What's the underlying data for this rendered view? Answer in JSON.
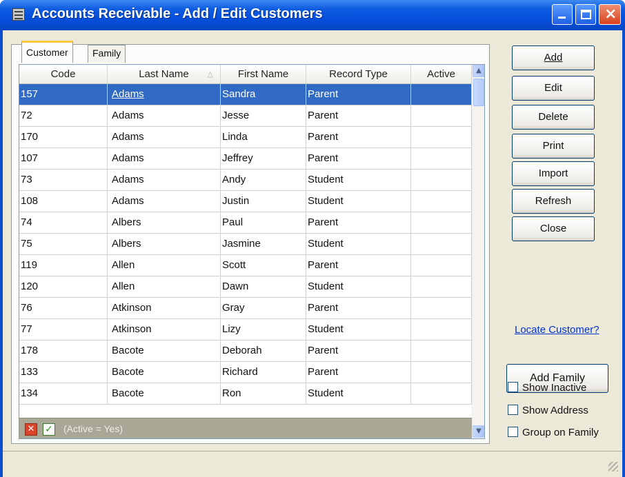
{
  "window": {
    "title": "Accounts Receivable - Add / Edit Customers",
    "close_glyph": "×"
  },
  "tabs": [
    {
      "label": "Customer",
      "active": true
    },
    {
      "label": "Family",
      "active": false
    }
  ],
  "grid": {
    "columns": [
      "Code",
      "Last Name",
      "First Name",
      "Record Type",
      "Active"
    ],
    "sort_column": "Last Name",
    "sort_icon": "sort-ascending-icon",
    "rows": [
      {
        "code": "157",
        "last": "Adams",
        "first": "Sandra",
        "type": "Parent",
        "active": "",
        "selected": true
      },
      {
        "code": "72",
        "last": "Adams",
        "first": "Jesse",
        "type": "Parent",
        "active": ""
      },
      {
        "code": "170",
        "last": "Adams",
        "first": "Linda",
        "type": "Parent",
        "active": ""
      },
      {
        "code": "107",
        "last": "Adams",
        "first": "Jeffrey",
        "type": "Parent",
        "active": ""
      },
      {
        "code": "73",
        "last": "Adams",
        "first": "Andy",
        "type": "Student",
        "active": ""
      },
      {
        "code": "108",
        "last": "Adams",
        "first": "Justin",
        "type": "Student",
        "active": ""
      },
      {
        "code": "74",
        "last": "Albers",
        "first": "Paul",
        "type": "Parent",
        "active": ""
      },
      {
        "code": "75",
        "last": "Albers",
        "first": "Jasmine",
        "type": "Student",
        "active": ""
      },
      {
        "code": "119",
        "last": "Allen",
        "first": "Scott",
        "type": "Parent",
        "active": ""
      },
      {
        "code": "120",
        "last": "Allen",
        "first": "Dawn",
        "type": "Student",
        "active": ""
      },
      {
        "code": "76",
        "last": "Atkinson",
        "first": "Gray",
        "type": "Parent",
        "active": ""
      },
      {
        "code": "77",
        "last": "Atkinson",
        "first": "Lizy",
        "type": "Student",
        "active": ""
      },
      {
        "code": "178",
        "last": "Bacote",
        "first": "Deborah",
        "type": "Parent",
        "active": ""
      },
      {
        "code": "133",
        "last": "Bacote",
        "first": "Richard",
        "type": "Parent",
        "active": ""
      },
      {
        "code": "134",
        "last": "Bacote",
        "first": "Ron",
        "type": "Student",
        "active": ""
      }
    ],
    "filter_text": "(Active = Yes)"
  },
  "buttons": {
    "add": "Add",
    "edit": "Edit",
    "delete": "Delete",
    "print": "Print",
    "import": "Import",
    "refresh": "Refresh",
    "close": "Close",
    "add_family": "Add Family"
  },
  "locate_link": "Locate Customer?",
  "options": {
    "show_inactive": {
      "label": "Show Inactive",
      "checked": false
    },
    "show_address": {
      "label": "Show Address",
      "checked": false
    },
    "group_on_family": {
      "label": "Group on Family",
      "checked": false
    }
  },
  "colors": {
    "selection": "#316ac5",
    "titlebar": "#0550dc",
    "link": "#0033cc"
  }
}
